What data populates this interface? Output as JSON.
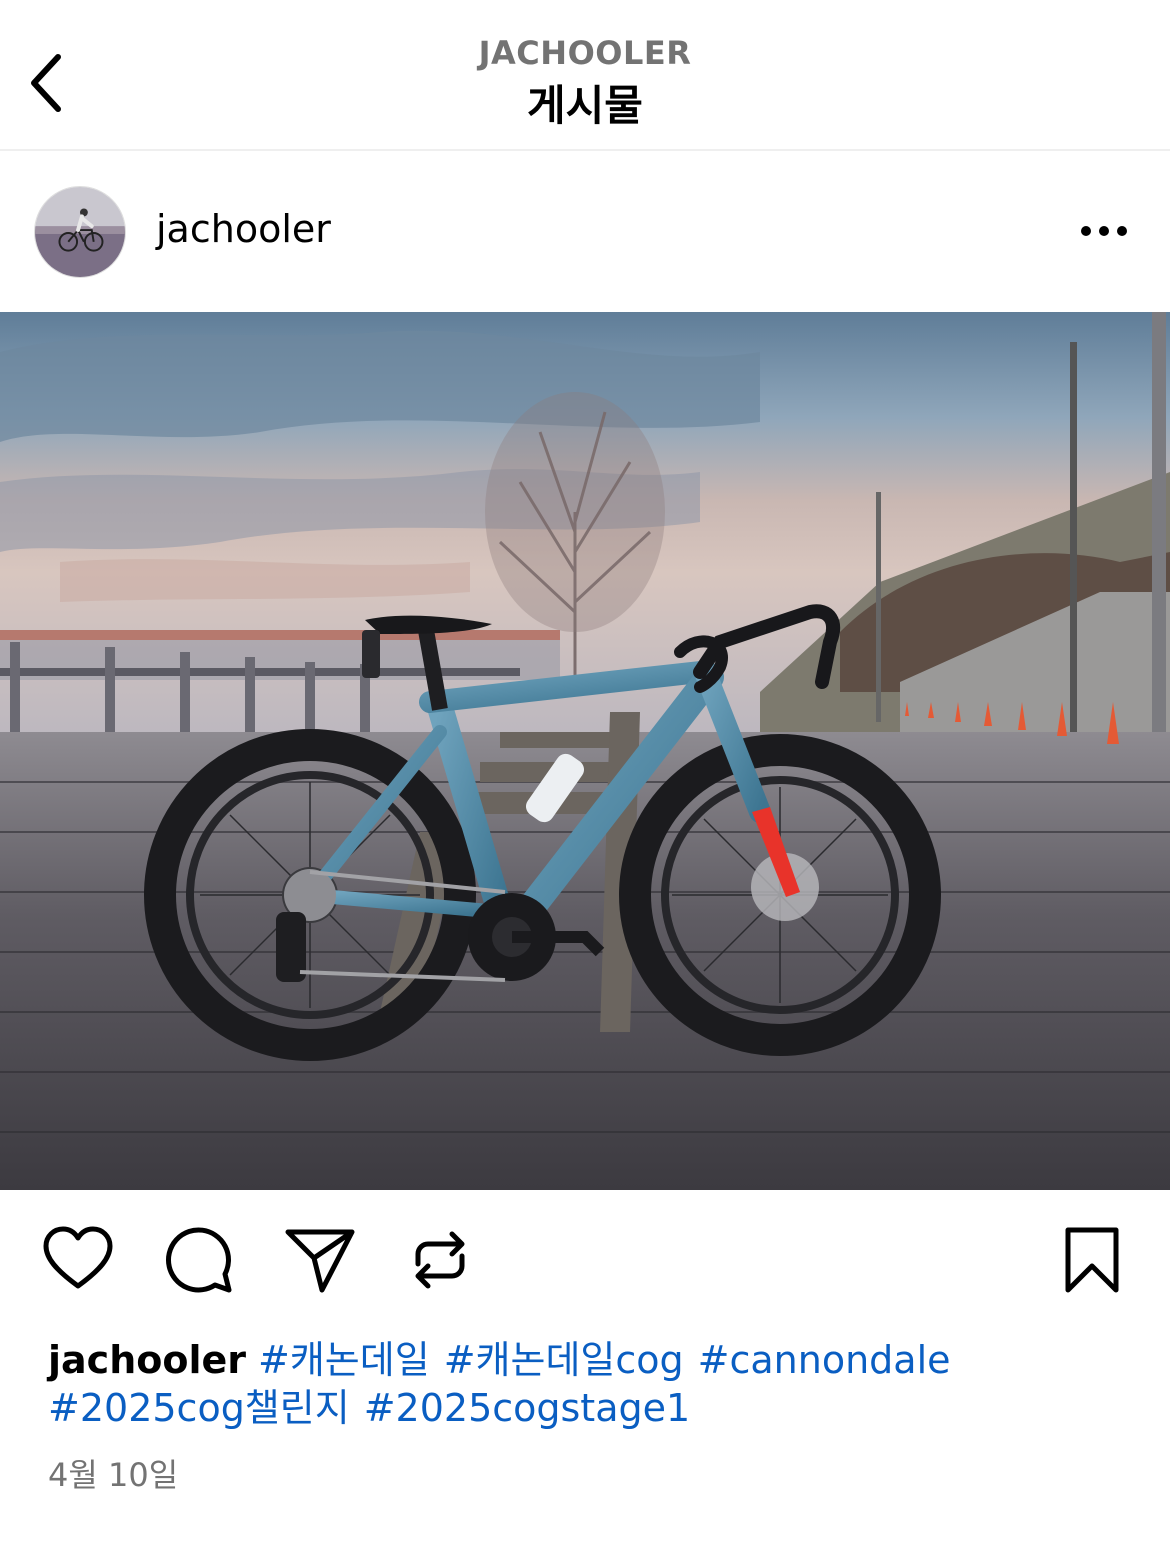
{
  "header": {
    "account_label": "JACHOOLER",
    "title": "게시물"
  },
  "post": {
    "username": "jachooler",
    "more_icon": "more-horizontal-icon",
    "image_alt": "Blue Cannondale road bike parked by a bench on a riverside boardwalk at dusk",
    "actions": {
      "like_icon": "heart-icon",
      "comment_icon": "comment-icon",
      "share_icon": "send-icon",
      "repost_icon": "repost-icon",
      "save_icon": "bookmark-icon"
    },
    "caption": {
      "username": "jachooler",
      "hashtags": [
        "#캐논데일",
        "#캐논데일cog",
        "#cannondale",
        "#2025cog챌린지",
        "#2025cogstage1"
      ]
    },
    "date": "4월 10일"
  },
  "colors": {
    "hashtag": "#0a5ec2",
    "secondary_text": "#737373",
    "bike_frame": "#4f8aa6",
    "fork_accent": "#e8332a"
  }
}
